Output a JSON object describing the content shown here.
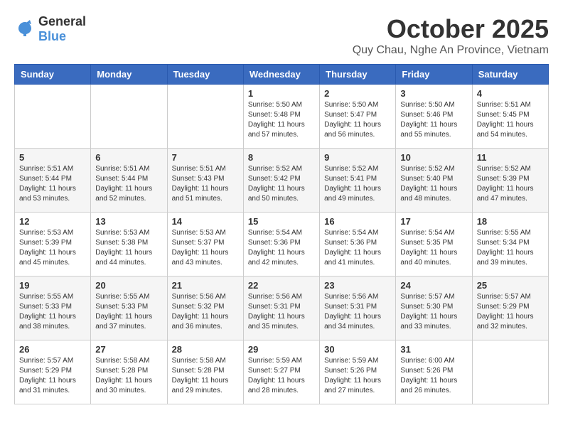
{
  "logo": {
    "text_general": "General",
    "text_blue": "Blue"
  },
  "header": {
    "month": "October 2025",
    "location": "Quy Chau, Nghe An Province, Vietnam"
  },
  "weekdays": [
    "Sunday",
    "Monday",
    "Tuesday",
    "Wednesday",
    "Thursday",
    "Friday",
    "Saturday"
  ],
  "weeks": [
    [
      {
        "day": "",
        "info": ""
      },
      {
        "day": "",
        "info": ""
      },
      {
        "day": "",
        "info": ""
      },
      {
        "day": "1",
        "info": "Sunrise: 5:50 AM\nSunset: 5:48 PM\nDaylight: 11 hours and 57 minutes."
      },
      {
        "day": "2",
        "info": "Sunrise: 5:50 AM\nSunset: 5:47 PM\nDaylight: 11 hours and 56 minutes."
      },
      {
        "day": "3",
        "info": "Sunrise: 5:50 AM\nSunset: 5:46 PM\nDaylight: 11 hours and 55 minutes."
      },
      {
        "day": "4",
        "info": "Sunrise: 5:51 AM\nSunset: 5:45 PM\nDaylight: 11 hours and 54 minutes."
      }
    ],
    [
      {
        "day": "5",
        "info": "Sunrise: 5:51 AM\nSunset: 5:44 PM\nDaylight: 11 hours and 53 minutes."
      },
      {
        "day": "6",
        "info": "Sunrise: 5:51 AM\nSunset: 5:44 PM\nDaylight: 11 hours and 52 minutes."
      },
      {
        "day": "7",
        "info": "Sunrise: 5:51 AM\nSunset: 5:43 PM\nDaylight: 11 hours and 51 minutes."
      },
      {
        "day": "8",
        "info": "Sunrise: 5:52 AM\nSunset: 5:42 PM\nDaylight: 11 hours and 50 minutes."
      },
      {
        "day": "9",
        "info": "Sunrise: 5:52 AM\nSunset: 5:41 PM\nDaylight: 11 hours and 49 minutes."
      },
      {
        "day": "10",
        "info": "Sunrise: 5:52 AM\nSunset: 5:40 PM\nDaylight: 11 hours and 48 minutes."
      },
      {
        "day": "11",
        "info": "Sunrise: 5:52 AM\nSunset: 5:39 PM\nDaylight: 11 hours and 47 minutes."
      }
    ],
    [
      {
        "day": "12",
        "info": "Sunrise: 5:53 AM\nSunset: 5:39 PM\nDaylight: 11 hours and 45 minutes."
      },
      {
        "day": "13",
        "info": "Sunrise: 5:53 AM\nSunset: 5:38 PM\nDaylight: 11 hours and 44 minutes."
      },
      {
        "day": "14",
        "info": "Sunrise: 5:53 AM\nSunset: 5:37 PM\nDaylight: 11 hours and 43 minutes."
      },
      {
        "day": "15",
        "info": "Sunrise: 5:54 AM\nSunset: 5:36 PM\nDaylight: 11 hours and 42 minutes."
      },
      {
        "day": "16",
        "info": "Sunrise: 5:54 AM\nSunset: 5:36 PM\nDaylight: 11 hours and 41 minutes."
      },
      {
        "day": "17",
        "info": "Sunrise: 5:54 AM\nSunset: 5:35 PM\nDaylight: 11 hours and 40 minutes."
      },
      {
        "day": "18",
        "info": "Sunrise: 5:55 AM\nSunset: 5:34 PM\nDaylight: 11 hours and 39 minutes."
      }
    ],
    [
      {
        "day": "19",
        "info": "Sunrise: 5:55 AM\nSunset: 5:33 PM\nDaylight: 11 hours and 38 minutes."
      },
      {
        "day": "20",
        "info": "Sunrise: 5:55 AM\nSunset: 5:33 PM\nDaylight: 11 hours and 37 minutes."
      },
      {
        "day": "21",
        "info": "Sunrise: 5:56 AM\nSunset: 5:32 PM\nDaylight: 11 hours and 36 minutes."
      },
      {
        "day": "22",
        "info": "Sunrise: 5:56 AM\nSunset: 5:31 PM\nDaylight: 11 hours and 35 minutes."
      },
      {
        "day": "23",
        "info": "Sunrise: 5:56 AM\nSunset: 5:31 PM\nDaylight: 11 hours and 34 minutes."
      },
      {
        "day": "24",
        "info": "Sunrise: 5:57 AM\nSunset: 5:30 PM\nDaylight: 11 hours and 33 minutes."
      },
      {
        "day": "25",
        "info": "Sunrise: 5:57 AM\nSunset: 5:29 PM\nDaylight: 11 hours and 32 minutes."
      }
    ],
    [
      {
        "day": "26",
        "info": "Sunrise: 5:57 AM\nSunset: 5:29 PM\nDaylight: 11 hours and 31 minutes."
      },
      {
        "day": "27",
        "info": "Sunrise: 5:58 AM\nSunset: 5:28 PM\nDaylight: 11 hours and 30 minutes."
      },
      {
        "day": "28",
        "info": "Sunrise: 5:58 AM\nSunset: 5:28 PM\nDaylight: 11 hours and 29 minutes."
      },
      {
        "day": "29",
        "info": "Sunrise: 5:59 AM\nSunset: 5:27 PM\nDaylight: 11 hours and 28 minutes."
      },
      {
        "day": "30",
        "info": "Sunrise: 5:59 AM\nSunset: 5:26 PM\nDaylight: 11 hours and 27 minutes."
      },
      {
        "day": "31",
        "info": "Sunrise: 6:00 AM\nSunset: 5:26 PM\nDaylight: 11 hours and 26 minutes."
      },
      {
        "day": "",
        "info": ""
      }
    ]
  ]
}
